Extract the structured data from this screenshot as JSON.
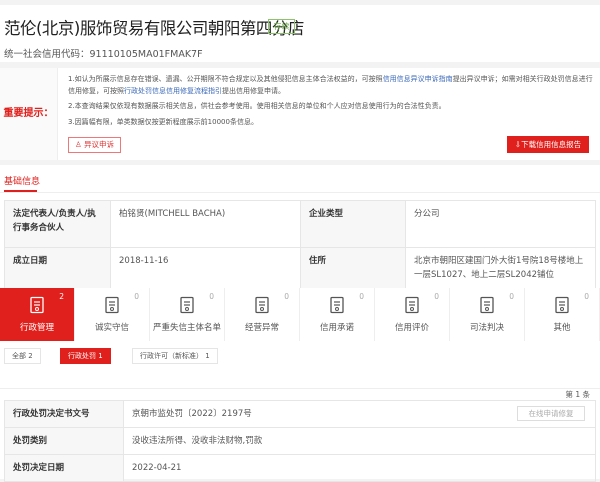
{
  "company": {
    "name": "范伦(北京)服饰贸易有限公司朝阳第四分店",
    "status": "存续",
    "credit_code_label": "统一社会信用代码：",
    "credit_code": "91110105MA01FMAK7F"
  },
  "notice": {
    "label": "重要提示：",
    "line1a": "1.如认为所展示信息存在错误、遗漏、公开期限不符合规定以及其他侵犯信息主体合法权益的，可按照",
    "link1": "信用信息异议申诉指南",
    "line1b": "提出异议申诉；如需对相关行政",
    "line1c": "处罚信息进行信用修复，可按照",
    "link2": "行政处罚信息信用修复流程指引",
    "line1d": "提出信用修复申请。",
    "line2": "2.本查询结果仅依现有数据展示相关信息，供社会参考使用。使用相关信息的单位和个人应对信息使用行为的合法性负责。",
    "line3": "3.因篇幅有限，单类数据仅按更新程度展示前10000条信息。",
    "dispute_button": "异议申诉",
    "download_button": "下载信用信息报告"
  },
  "basic": {
    "title": "基础信息",
    "rows": [
      {
        "k1": "法定代表人/负责人/执行事务合伙人",
        "v1": "柏铭贤(MITCHELL BACHA)",
        "k2": "企业类型",
        "v2": "分公司"
      },
      {
        "k1": "成立日期",
        "v1": "2018-11-16",
        "k2": "住所",
        "v2": "北京市朝阳区建国门外大街1号院18号楼地上一层SL1027、地上二层SL2042铺位"
      }
    ]
  },
  "tabs": [
    {
      "label": "行政管理",
      "count": "2",
      "icon": "document-person-icon"
    },
    {
      "label": "诚实守信",
      "count": "0",
      "icon": "shield-icon"
    },
    {
      "label": "严重失信主体名单",
      "count": "0",
      "icon": "printer-list-icon"
    },
    {
      "label": "经营异常",
      "count": "0",
      "icon": "alarm-icon"
    },
    {
      "label": "信用承诺",
      "count": "0",
      "icon": "certificate-icon"
    },
    {
      "label": "信用评价",
      "count": "0",
      "icon": "evaluation-icon"
    },
    {
      "label": "司法判决",
      "count": "0",
      "icon": "judgment-icon"
    },
    {
      "label": "其他",
      "count": "0",
      "icon": "other-doc-icon"
    }
  ],
  "subtabs": [
    {
      "label": "全部",
      "count": "2"
    },
    {
      "label": "行政处罚",
      "count": "1"
    },
    {
      "label": "行政许可（新标准）",
      "count": "1"
    }
  ],
  "detail": {
    "count": "第 1 条",
    "repair_button": "在线申请修复",
    "rows": [
      {
        "k": "行政处罚决定书文号",
        "v": "京朝市监处罚〔2022〕2197号"
      },
      {
        "k": "处罚类别",
        "v": "没收违法所得、没收非法财物,罚款"
      },
      {
        "k": "处罚决定日期",
        "v": "2022-04-21"
      }
    ]
  }
}
